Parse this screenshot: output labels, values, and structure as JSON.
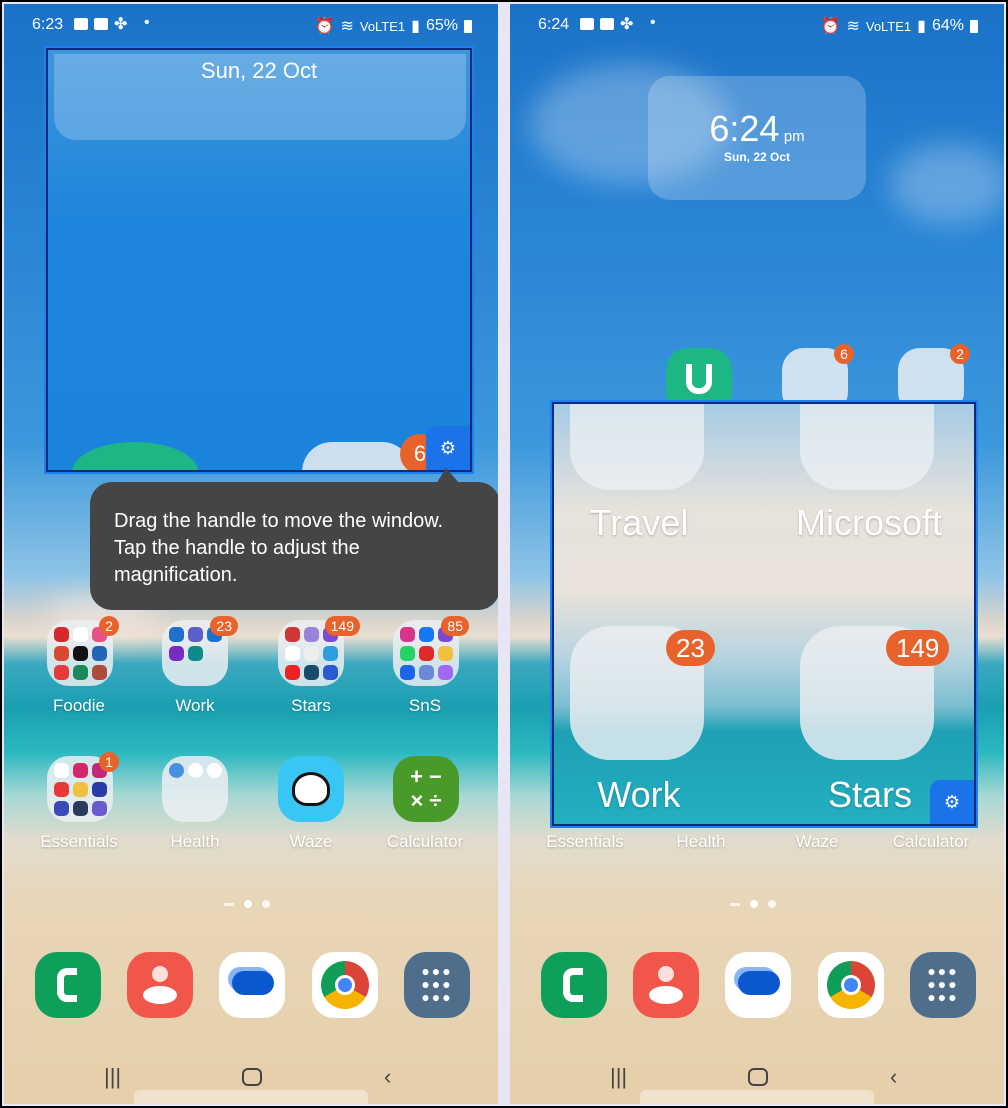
{
  "left": {
    "status": {
      "time": "6:23",
      "network": "VoLTE1",
      "battery": "65%"
    },
    "magnifier": {
      "date_label": "Sun, 22 Oct",
      "partial_badge": "6"
    },
    "tooltip": {
      "text": "Drag the handle to move the window. Tap the handle to adjust the magnification."
    },
    "row1": [
      {
        "label": "Foodie",
        "badge": "2",
        "type": "folder"
      },
      {
        "label": "Work",
        "badge": "23",
        "type": "folder"
      },
      {
        "label": "Stars",
        "badge": "149",
        "type": "folder"
      },
      {
        "label": "SnS",
        "badge": "85",
        "type": "folder"
      }
    ],
    "row2": [
      {
        "label": "Essentials",
        "badge": "1",
        "type": "folder"
      },
      {
        "label": "Health",
        "type": "folder"
      },
      {
        "label": "Waze",
        "type": "app"
      },
      {
        "label": "Calculator",
        "type": "app"
      }
    ]
  },
  "right": {
    "status": {
      "time": "6:24",
      "network": "VoLTE1",
      "battery": "64%"
    },
    "clock_widget": {
      "time": "6:24",
      "ampm": "pm",
      "date": "Sun, 22 Oct"
    },
    "top_badges": [
      "6",
      "2"
    ],
    "magnifier": {
      "folders": [
        {
          "label": "Travel"
        },
        {
          "label": "Microsoft"
        },
        {
          "label": "Work",
          "badge": "23"
        },
        {
          "label": "Stars",
          "badge": "149"
        }
      ]
    },
    "row2": [
      {
        "label": "Essentials"
      },
      {
        "label": "Health"
      },
      {
        "label": "Waze"
      },
      {
        "label": "Calculator"
      }
    ]
  },
  "dock": [
    {
      "name": "Phone",
      "icon": "phone-icon",
      "color": "#0e9f5a"
    },
    {
      "name": "Contacts",
      "icon": "contacts-icon",
      "color": "#f0574a"
    },
    {
      "name": "Messages",
      "icon": "messages-icon",
      "color": "#ffffff"
    },
    {
      "name": "Chrome",
      "icon": "chrome-icon",
      "color": "#ffffff"
    },
    {
      "name": "Apps",
      "icon": "app-drawer-icon",
      "color": "#4f6e8c"
    }
  ],
  "colors": {
    "badge": "#e8632b",
    "magnifier_handle": "#1a73e8",
    "tooltip_bg": "#454545"
  }
}
